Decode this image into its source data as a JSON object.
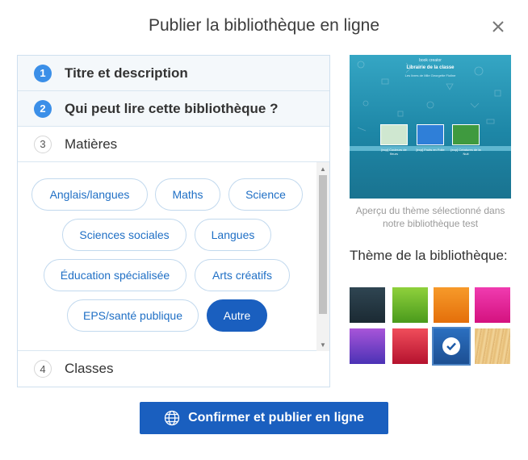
{
  "dialog": {
    "title": "Publier la bibliothèque en ligne"
  },
  "steps": [
    {
      "number": "1",
      "label": "Titre et description",
      "state": "done"
    },
    {
      "number": "2",
      "label": "Qui peut lire cette bibliothèque ?",
      "state": "done"
    },
    {
      "number": "3",
      "label": "Matières",
      "state": "current"
    },
    {
      "number": "4",
      "label": "Classes",
      "state": "todo"
    }
  ],
  "subjects": [
    {
      "label": "Anglais/langues",
      "selected": false
    },
    {
      "label": "Maths",
      "selected": false
    },
    {
      "label": "Science",
      "selected": false
    },
    {
      "label": "Sciences sociales",
      "selected": false
    },
    {
      "label": "Langues",
      "selected": false
    },
    {
      "label": "Éducation spécialisée",
      "selected": false
    },
    {
      "label": "Arts créatifs",
      "selected": false
    },
    {
      "label": "EPS/santé publique",
      "selected": false
    },
    {
      "label": "Autre",
      "selected": true
    }
  ],
  "preview": {
    "logo_text": "book creator",
    "title": "Librairie de la classe",
    "subtitle": "Les livres de Mlle Georgette Fioline",
    "books": [
      "[ecp] Couleurs de fleurs",
      "[ecp] Fruits en Folie",
      "[ecp] Créatures de la Nuit"
    ],
    "caption": "Aperçu du thème sélectionné dans notre bibliothèque test"
  },
  "theme": {
    "label": "Thème de la bibliothèque:",
    "swatches": [
      {
        "name": "dark-slate",
        "colors": [
          "#2f4552",
          "#1b2a33"
        ],
        "selected": false
      },
      {
        "name": "green",
        "colors": [
          "#8fd13c",
          "#4a9a1c"
        ],
        "selected": false
      },
      {
        "name": "orange",
        "colors": [
          "#f79a2a",
          "#e46f0a"
        ],
        "selected": false
      },
      {
        "name": "magenta",
        "colors": [
          "#f03bb0",
          "#d4127f"
        ],
        "selected": false
      },
      {
        "name": "purple",
        "colors": [
          "#a855d9",
          "#4b32b5"
        ],
        "selected": false
      },
      {
        "name": "red",
        "colors": [
          "#f04d5b",
          "#b5122e"
        ],
        "selected": false
      },
      {
        "name": "blue",
        "colors": [
          "#2b6fc0",
          "#1c4f92"
        ],
        "selected": true
      },
      {
        "name": "wood",
        "colors": [
          "#f1cf8f",
          "#ddb06a"
        ],
        "selected": false
      }
    ]
  },
  "actions": {
    "confirm_label": "Confirmer et publier en ligne"
  },
  "colors": {
    "accent": "#1a5fbf",
    "step_badge": "#3b8fe8",
    "pill_text": "#1f6fc5",
    "pill_border": "#c2d9ee"
  }
}
